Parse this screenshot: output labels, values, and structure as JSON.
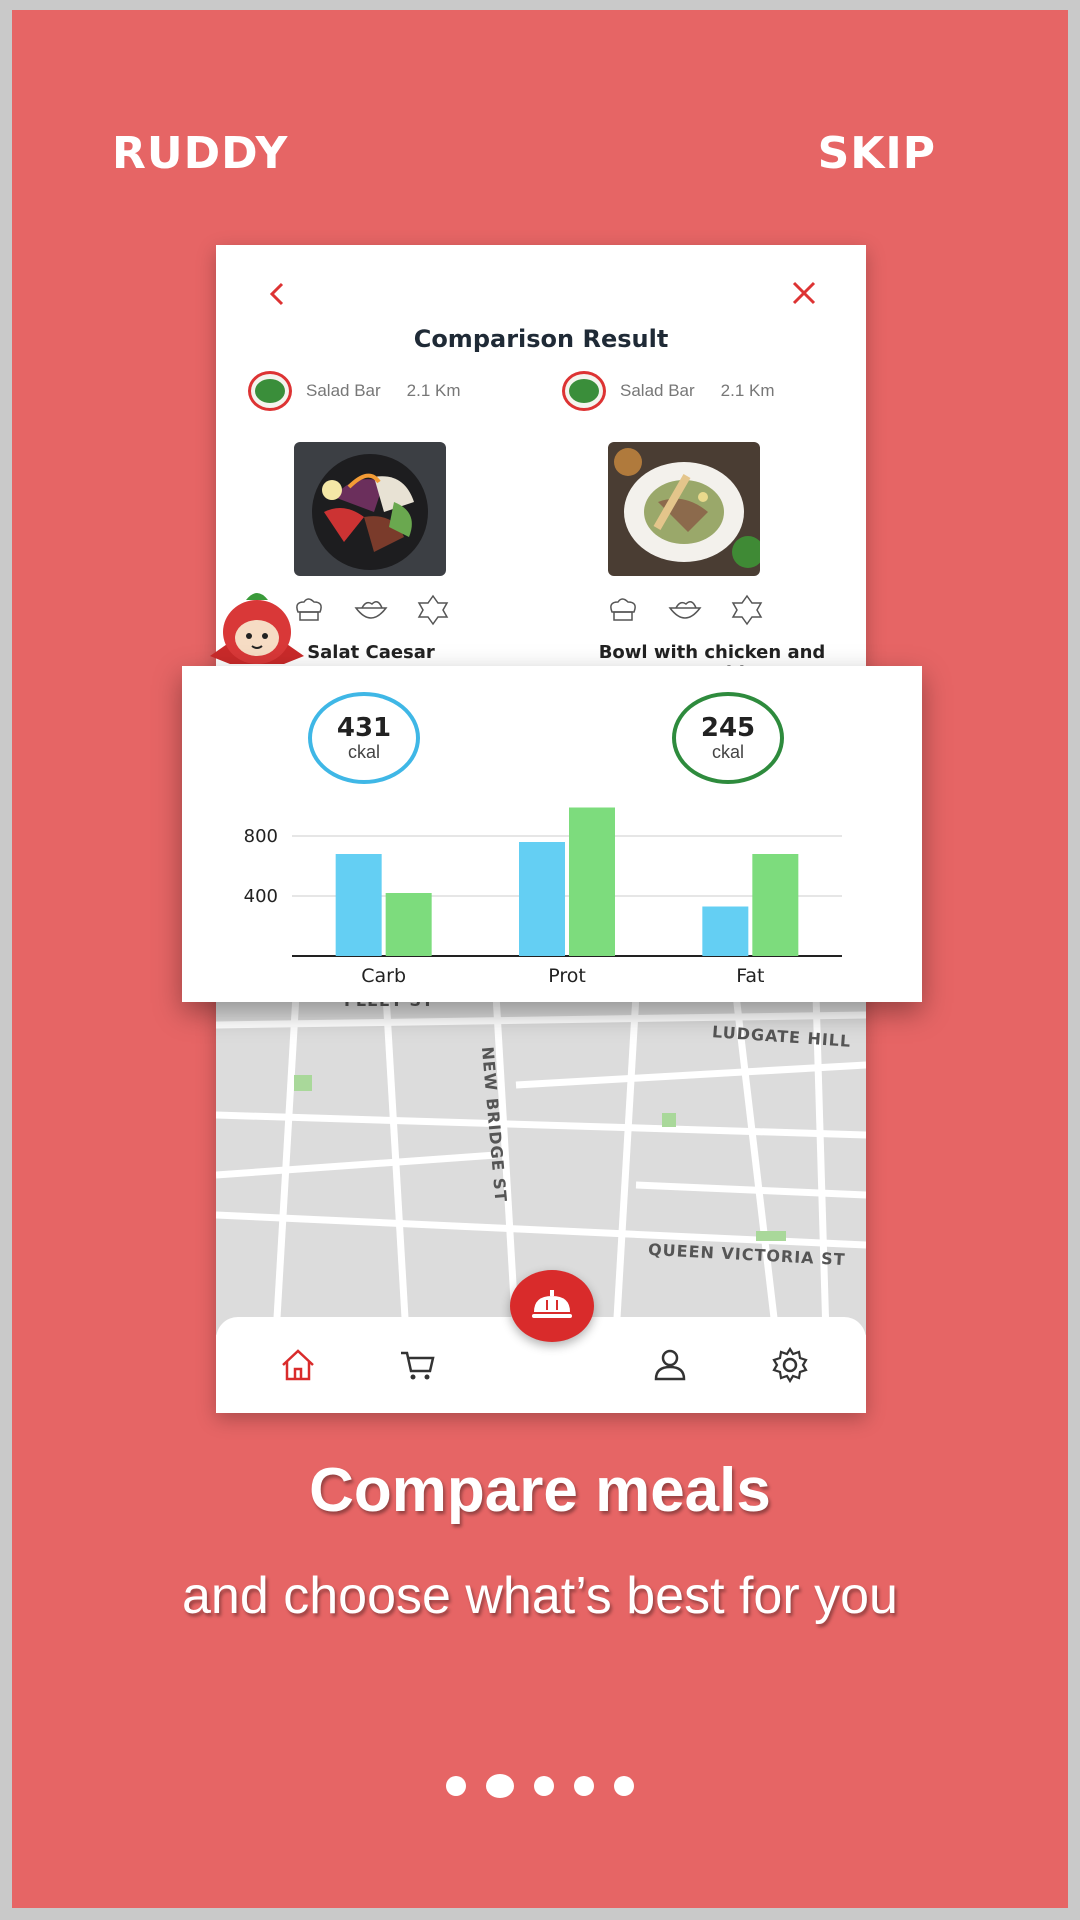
{
  "header": {
    "brand": "RUDDY",
    "skip": "SKIP"
  },
  "comparison": {
    "title": "Comparison Result",
    "meals": [
      {
        "restaurant": "Salad Bar",
        "distance": "2.1 Km",
        "name": "Salat Caesar",
        "tags": [
          "chef-icon",
          "bowl-icon",
          "halal-icon"
        ]
      },
      {
        "restaurant": "Salad Bar",
        "distance": "2.1 Km",
        "name": "Bowl with chicken and vegetables",
        "tags": [
          "chef-icon",
          "bowl-icon",
          "halal-icon"
        ]
      }
    ],
    "kcal": [
      {
        "value": "431",
        "unit": "ckal",
        "color": "#3fb7e6"
      },
      {
        "value": "245",
        "unit": "ckal",
        "color": "#2e8b3d"
      }
    ]
  },
  "chart_data": {
    "type": "bar",
    "categories": [
      "Carb",
      "Prot",
      "Fat"
    ],
    "series": [
      {
        "values": [
          680,
          760,
          330
        ],
        "color": "#64cff3"
      },
      {
        "values": [
          420,
          990,
          680
        ],
        "color": "#7ddc7d"
      }
    ],
    "yticks": [
      400,
      800
    ],
    "ylim": [
      0,
      1000
    ]
  },
  "map": {
    "labels": [
      "FLEET ST",
      "LUDGATE HILL",
      "NEW BRIDGE ST",
      "QUEEN VICTORIA ST"
    ]
  },
  "nav": {
    "items": [
      "home-icon",
      "cart-icon",
      "profile-icon",
      "settings-icon"
    ],
    "accent": "#d92b2b"
  },
  "onboarding": {
    "headline": "Compare meals",
    "subline": "and choose what’s best for you",
    "pages": 5,
    "active_page": 2
  }
}
